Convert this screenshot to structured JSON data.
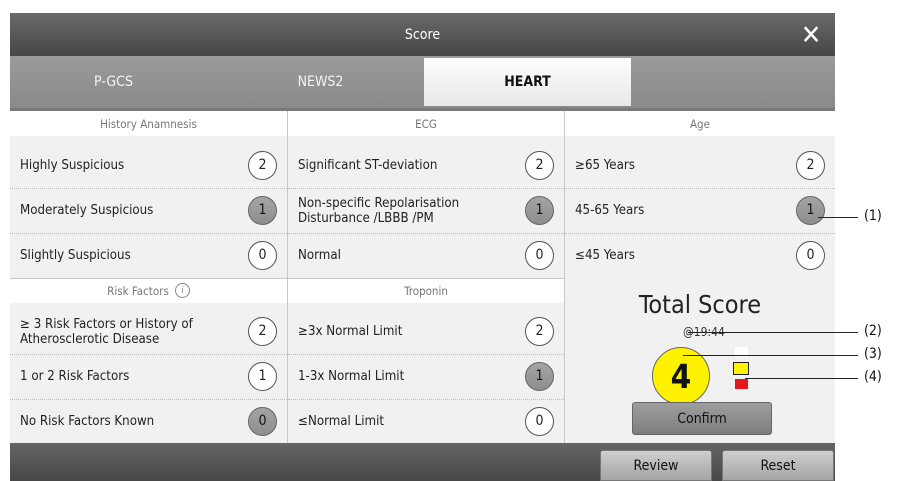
{
  "window": {
    "title": "Score"
  },
  "tabs": [
    {
      "label": "P-GCS",
      "active": false
    },
    {
      "label": "NEWS2",
      "active": false
    },
    {
      "label": "HEART",
      "active": true
    }
  ],
  "sections": {
    "history": {
      "title": "History Anamnesis",
      "items": [
        {
          "label": "Highly Suspicious",
          "score": "2",
          "selected": false
        },
        {
          "label": "Moderately Suspicious",
          "score": "1",
          "selected": true
        },
        {
          "label": "Slightly Suspicious",
          "score": "0",
          "selected": false
        }
      ]
    },
    "ecg": {
      "title": "ECG",
      "items": [
        {
          "label": "Significant ST-deviation",
          "score": "2",
          "selected": false
        },
        {
          "label": "Non-specific Repolarisation Disturbance /LBBB /PM",
          "score": "1",
          "selected": true
        },
        {
          "label": "Normal",
          "score": "0",
          "selected": false
        }
      ]
    },
    "age": {
      "title": "Age",
      "items": [
        {
          "label": "≥65 Years",
          "score": "2",
          "selected": false
        },
        {
          "label": "45-65 Years",
          "score": "1",
          "selected": true
        },
        {
          "label": "≤45 Years",
          "score": "0",
          "selected": false
        }
      ]
    },
    "risk": {
      "title": "Risk Factors",
      "info_icon": "info-icon",
      "items": [
        {
          "label": "≥ 3 Risk Factors or History of Atherosclerotic Disease",
          "score": "2",
          "selected": false
        },
        {
          "label": "1 or 2 Risk Factors",
          "score": "1",
          "selected": false
        },
        {
          "label": "No Risk Factors Known",
          "score": "0",
          "selected": true
        }
      ]
    },
    "troponin": {
      "title": "Troponin",
      "items": [
        {
          "label": "≥3x Normal Limit",
          "score": "2",
          "selected": false
        },
        {
          "label": "1-3x Normal Limit",
          "score": "1",
          "selected": true
        },
        {
          "label": "≤Normal Limit",
          "score": "0",
          "selected": false
        }
      ]
    }
  },
  "total": {
    "title": "Total Score",
    "time": "@19:44",
    "value": "4",
    "value_color": "#fff200",
    "risk_levels": [
      {
        "level": "low",
        "color": "#ffffff",
        "active": false
      },
      {
        "level": "moderate",
        "color": "#fff200",
        "active": true
      },
      {
        "level": "high",
        "color": "#e8171b",
        "active": false
      }
    ],
    "confirm_label": "Confirm"
  },
  "footer": {
    "review_label": "Review",
    "reset_label": "Reset"
  },
  "callouts": [
    "(1)",
    "(2)",
    "(3)",
    "(4)"
  ]
}
